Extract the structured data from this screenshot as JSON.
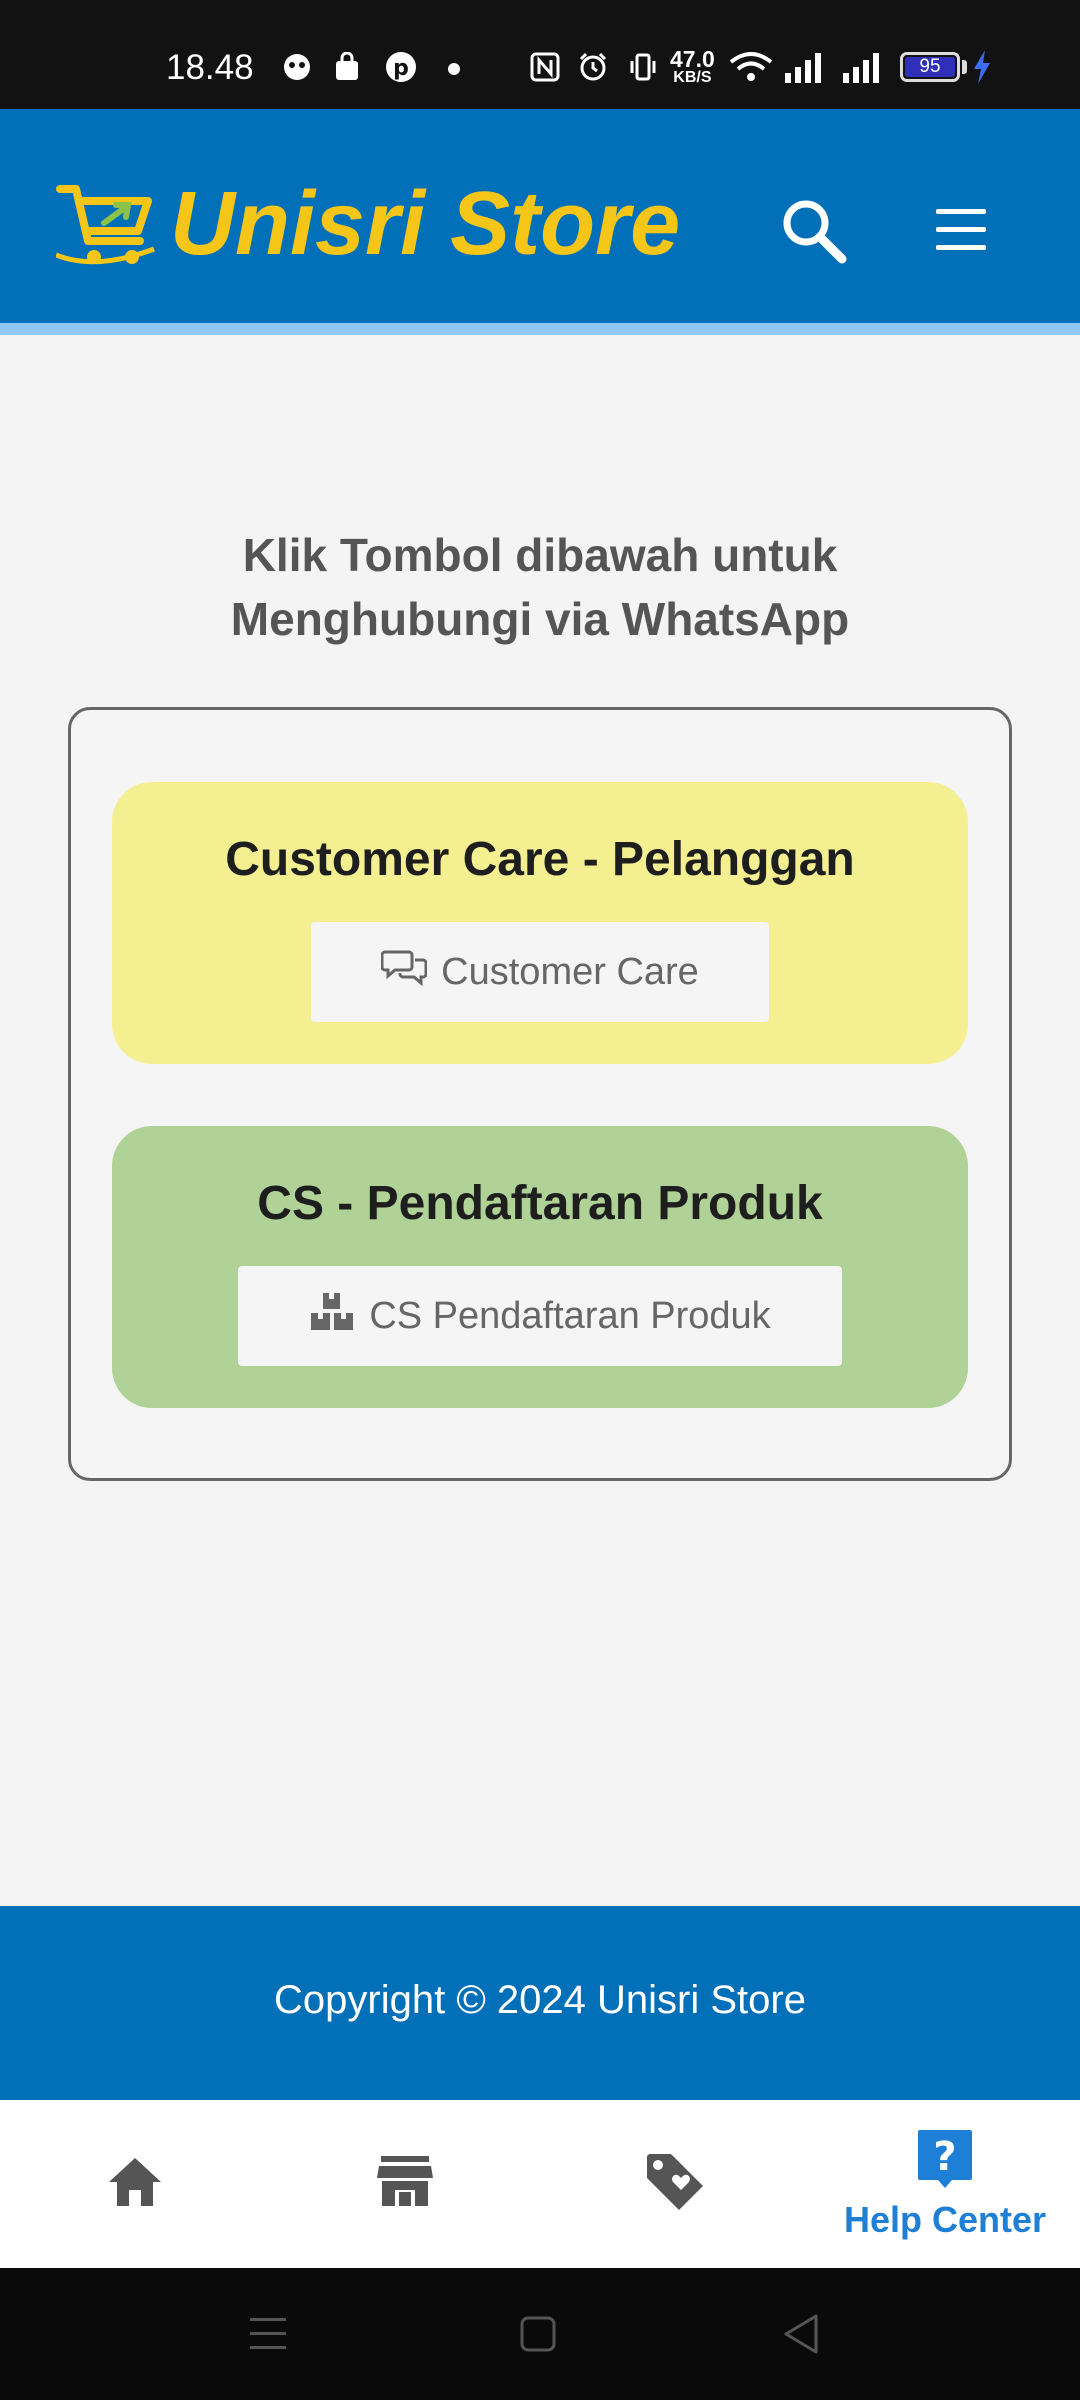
{
  "status_bar": {
    "time": "18.48",
    "net_speed_value": "47.0",
    "net_speed_unit": "KB/S",
    "battery_level": "95"
  },
  "header": {
    "logo_text": "Unisri Store",
    "search_icon": "search-icon",
    "menu_icon": "hamburger-menu-icon"
  },
  "main": {
    "intro_text": "Klik Tombol dibawah untuk Menghubungi via WhatsApp",
    "cards": [
      {
        "title": "Customer Care - Pelanggan",
        "button_label": "Customer Care",
        "button_icon": "chat-bubbles-icon",
        "bg_color": "#f4f091"
      },
      {
        "title": "CS - Pendaftaran Produk",
        "button_label": "CS Pendaftaran Produk",
        "button_icon": "boxes-icon",
        "bg_color": "#b0d297"
      }
    ]
  },
  "footer": {
    "copyright": "Copyright © 2024 Unisri Store"
  },
  "bottom_nav": {
    "items": [
      {
        "icon": "home-icon",
        "label": ""
      },
      {
        "icon": "store-icon",
        "label": ""
      },
      {
        "icon": "tag-heart-icon",
        "label": ""
      },
      {
        "icon": "help-icon",
        "label": "Help Center",
        "active": true
      }
    ]
  },
  "colors": {
    "brand_blue": "#0270b8",
    "logo_yellow": "#f5c518",
    "active_nav": "#1e7fd6"
  }
}
